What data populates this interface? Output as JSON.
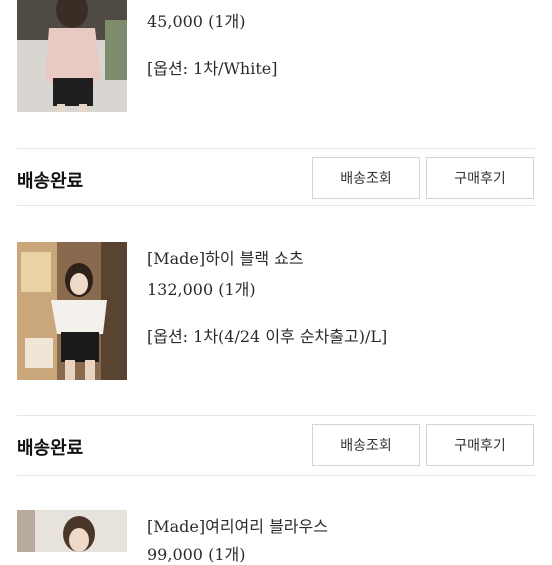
{
  "orders": [
    {
      "product_name": "",
      "price_qty": "45,000 (1개)",
      "option": "[옵션: 1차/White]"
    },
    {
      "status": "배송완료",
      "track_button": "배송조회",
      "review_button": "구매후기",
      "product_name": "[Made]하이 블랙 쇼츠",
      "price_qty": "132,000 (1개)",
      "option": "[옵션: 1차(4/24 이후 순차출고)/L]"
    },
    {
      "status": "배송완료",
      "track_button": "배송조회",
      "review_button": "구매후기",
      "product_name": "[Made]여리여리 블라우스",
      "price_qty": "99,000 (1개)"
    }
  ]
}
